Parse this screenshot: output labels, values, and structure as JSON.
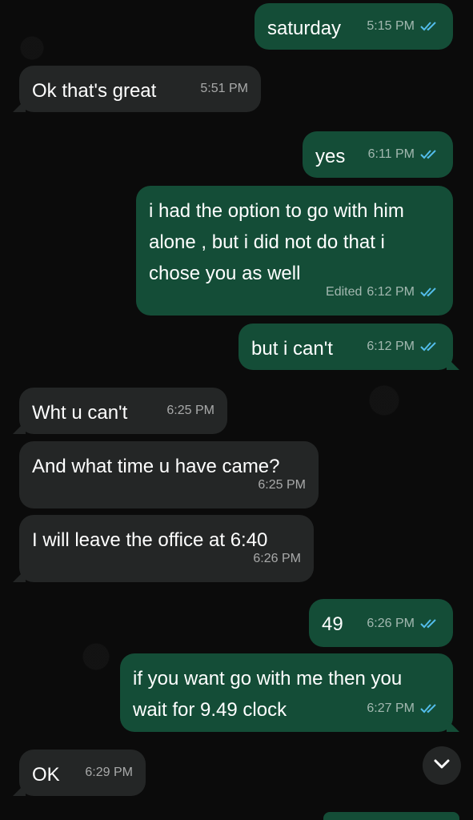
{
  "conversation": {
    "messages": [
      {
        "dir": "out",
        "text": "saturday",
        "time": "5:15 PM",
        "edited": ""
      },
      {
        "dir": "in",
        "text": "Ok that's great",
        "time": "5:51 PM",
        "edited": ""
      },
      {
        "dir": "out",
        "text": "yes",
        "time": "6:11 PM",
        "edited": ""
      },
      {
        "dir": "out",
        "text": "i had the option to go with him\nalone , but i did not do that i\nchose you as well",
        "time": "6:12 PM",
        "edited": "Edited"
      },
      {
        "dir": "out",
        "text": "but i can't",
        "time": "6:12 PM",
        "edited": ""
      },
      {
        "dir": "in",
        "text": "Wht u can't",
        "time": "6:25 PM",
        "edited": ""
      },
      {
        "dir": "in",
        "text": "And what time u have came?",
        "time": "6:25 PM",
        "edited": ""
      },
      {
        "dir": "in",
        "text": "I will leave the office at 6:40",
        "time": "6:26 PM",
        "edited": ""
      },
      {
        "dir": "out",
        "text": "49",
        "time": "6:26 PM",
        "edited": ""
      },
      {
        "dir": "out",
        "text": "if you want go with me then you\nwait for 9.49 clock",
        "time": "6:27 PM",
        "edited": ""
      },
      {
        "dir": "in",
        "text": "OK",
        "time": "6:29 PM",
        "edited": ""
      }
    ]
  },
  "icons": {
    "read_receipt": "double-check-icon",
    "scroll_down": "chevron-down-icon"
  },
  "colors": {
    "outgoing_bubble": "#144d37",
    "incoming_bubble": "#242626",
    "background": "#0b0b0b",
    "read_tick": "#53bdeb"
  }
}
